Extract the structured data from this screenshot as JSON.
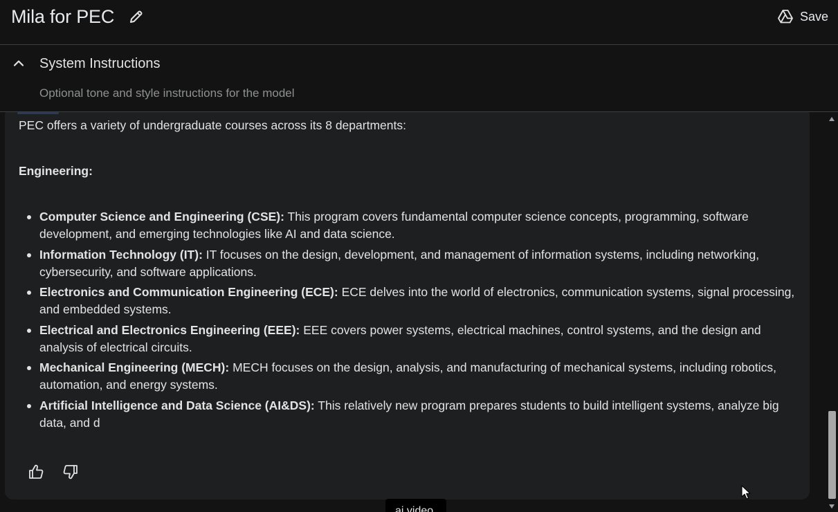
{
  "header": {
    "title": "Mila for PEC",
    "save_label": "Save",
    "edit_icon": "pencil-icon",
    "save_icon": "drive-icon"
  },
  "system_instructions": {
    "title": "System Instructions",
    "placeholder": "Optional tone and style instructions for the model",
    "toggle_icon": "chevron-up-icon"
  },
  "response": {
    "intro": "PEC offers a variety of undergraduate courses across its 8 departments:",
    "heading": "Engineering:",
    "items": [
      {
        "label": "Computer Science and Engineering (CSE):",
        "text": " This program covers fundamental computer science concepts, programming, software development, and emerging technologies like AI and data science."
      },
      {
        "label": "Information Technology (IT):",
        "text": " IT focuses on the design, development, and management of information systems, including networking, cybersecurity, and software applications."
      },
      {
        "label": "Electronics and Communication Engineering (ECE):",
        "text": " ECE delves into the world of electronics, communication systems, signal processing, and embedded systems."
      },
      {
        "label": "Electrical and Electronics Engineering (EEE):",
        "text": " EEE covers power systems, electrical machines, control systems, and the design and analysis of electrical circuits."
      },
      {
        "label": "Mechanical Engineering (MECH):",
        "text": " MECH focuses on the design, analysis, and manufacturing of mechanical systems, including robotics, automation, and energy systems."
      },
      {
        "label": "Artificial Intelligence and Data Science (AI&DS):",
        "text": " This relatively new program prepares students to build intelligent systems, analyze big data, and d"
      }
    ]
  },
  "feedback": {
    "thumbs_up_icon": "thumbs-up-icon",
    "thumbs_down_icon": "thumbs-down-icon"
  },
  "tooltip": {
    "text": "ai video"
  },
  "colors": {
    "background": "#131314",
    "card": "#1e1f20",
    "text": "#e3e3e3",
    "muted": "#8e918f",
    "divider": "#3c4043"
  }
}
